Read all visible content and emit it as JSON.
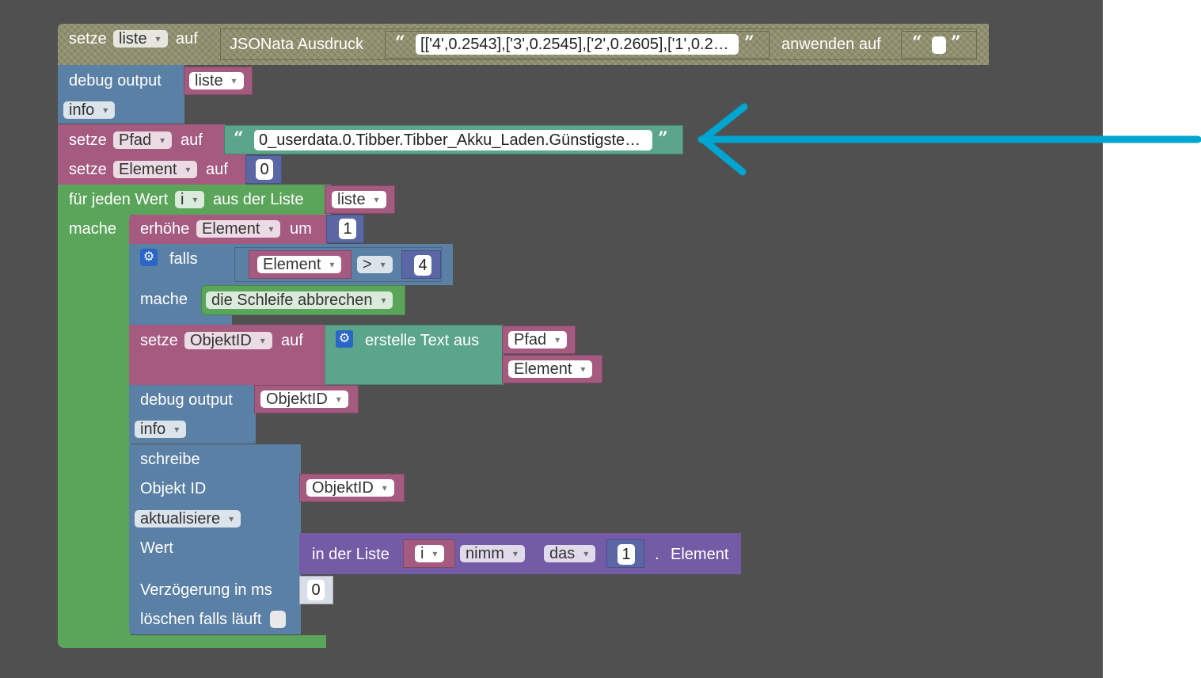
{
  "colors": {
    "workspace_bg": "#505050",
    "variables_block": "#a55b80",
    "text_block": "#5ba58c",
    "system_block": "#5b80a5",
    "loop_block": "#5ba55b",
    "list_block": "#745ba5",
    "math_block": "#5b67a5",
    "annotation_arrow": "#00a5d0"
  },
  "b1": {
    "setze": "setze",
    "var": "liste",
    "auf": "auf",
    "json_label": "JSONata Ausdruck",
    "expr": "[['4',0.2543],['3',0.2545],['2',0.2605],['1',0.2…",
    "anwenden": "anwenden auf"
  },
  "b2": {
    "label": "debug output",
    "var": "liste",
    "level": "info"
  },
  "b3": {
    "setze": "setze",
    "var": "Pfad",
    "auf": "auf",
    "text": "0_userdata.0.Tibber.Tibber_Akku_Laden.Günstigste…"
  },
  "b4": {
    "setze": "setze",
    "var": "Element",
    "auf": "auf",
    "num": "0"
  },
  "loop": {
    "label1": "für jeden Wert",
    "var": "i",
    "label2": "aus der Liste",
    "list": "liste",
    "mache": "mache"
  },
  "b5": {
    "label": "erhöhe",
    "var": "Element",
    "um": "um",
    "num": "1"
  },
  "if": {
    "falls": "falls",
    "var": "Element",
    "op": ">",
    "num": "4",
    "mache": "mache",
    "break": "die Schleife abbrechen"
  },
  "b6": {
    "setze": "setze",
    "var": "ObjektID",
    "auf": "auf",
    "create": "erstelle Text aus",
    "item1": "Pfad",
    "item2": "Element"
  },
  "b7": {
    "label": "debug output",
    "var": "ObjektID",
    "level": "info"
  },
  "write": {
    "label": "schreibe",
    "objid_label": "Objekt ID",
    "objid_var": "ObjektID",
    "mode": "aktualisiere",
    "wert": "Wert",
    "in_list": "in der Liste",
    "list_var": "i",
    "take": "nimm",
    "which": "das",
    "num": "1",
    "dot": ".",
    "element": "Element",
    "delay": "Verzögerung in ms",
    "delay_num": "0",
    "clear": "löschen falls läuft"
  }
}
